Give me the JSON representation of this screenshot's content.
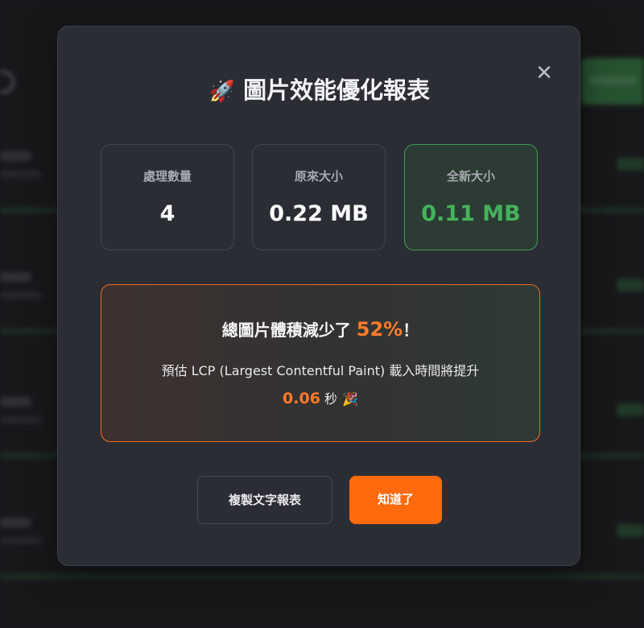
{
  "modal": {
    "title": "圖片效能優化報表",
    "close_glyph": "✕",
    "stats": [
      {
        "label": "處理數量",
        "value": "4"
      },
      {
        "label": "原來大小",
        "value": "0.22 MB"
      },
      {
        "label": "全新大小",
        "value": "0.11 MB"
      }
    ],
    "summary": {
      "headline_prefix": "總圖片體積減少了",
      "percent": "52%",
      "headline_suffix": "！",
      "detail": "預估 LCP (Largest Contentful Paint) 載入時間將提升",
      "seconds": "0.06",
      "seconds_unit": "秒"
    },
    "buttons": {
      "copy_label": "複製文字報表",
      "ok_label": "知道了"
    }
  },
  "colors": {
    "accent_orange": "#ff6a0d",
    "success_green": "#44b25b",
    "modal_bg": "#2b2d35"
  },
  "icons": {
    "title": "rocket-icon",
    "celebration": "party-popper-icon",
    "close": "close-icon"
  }
}
